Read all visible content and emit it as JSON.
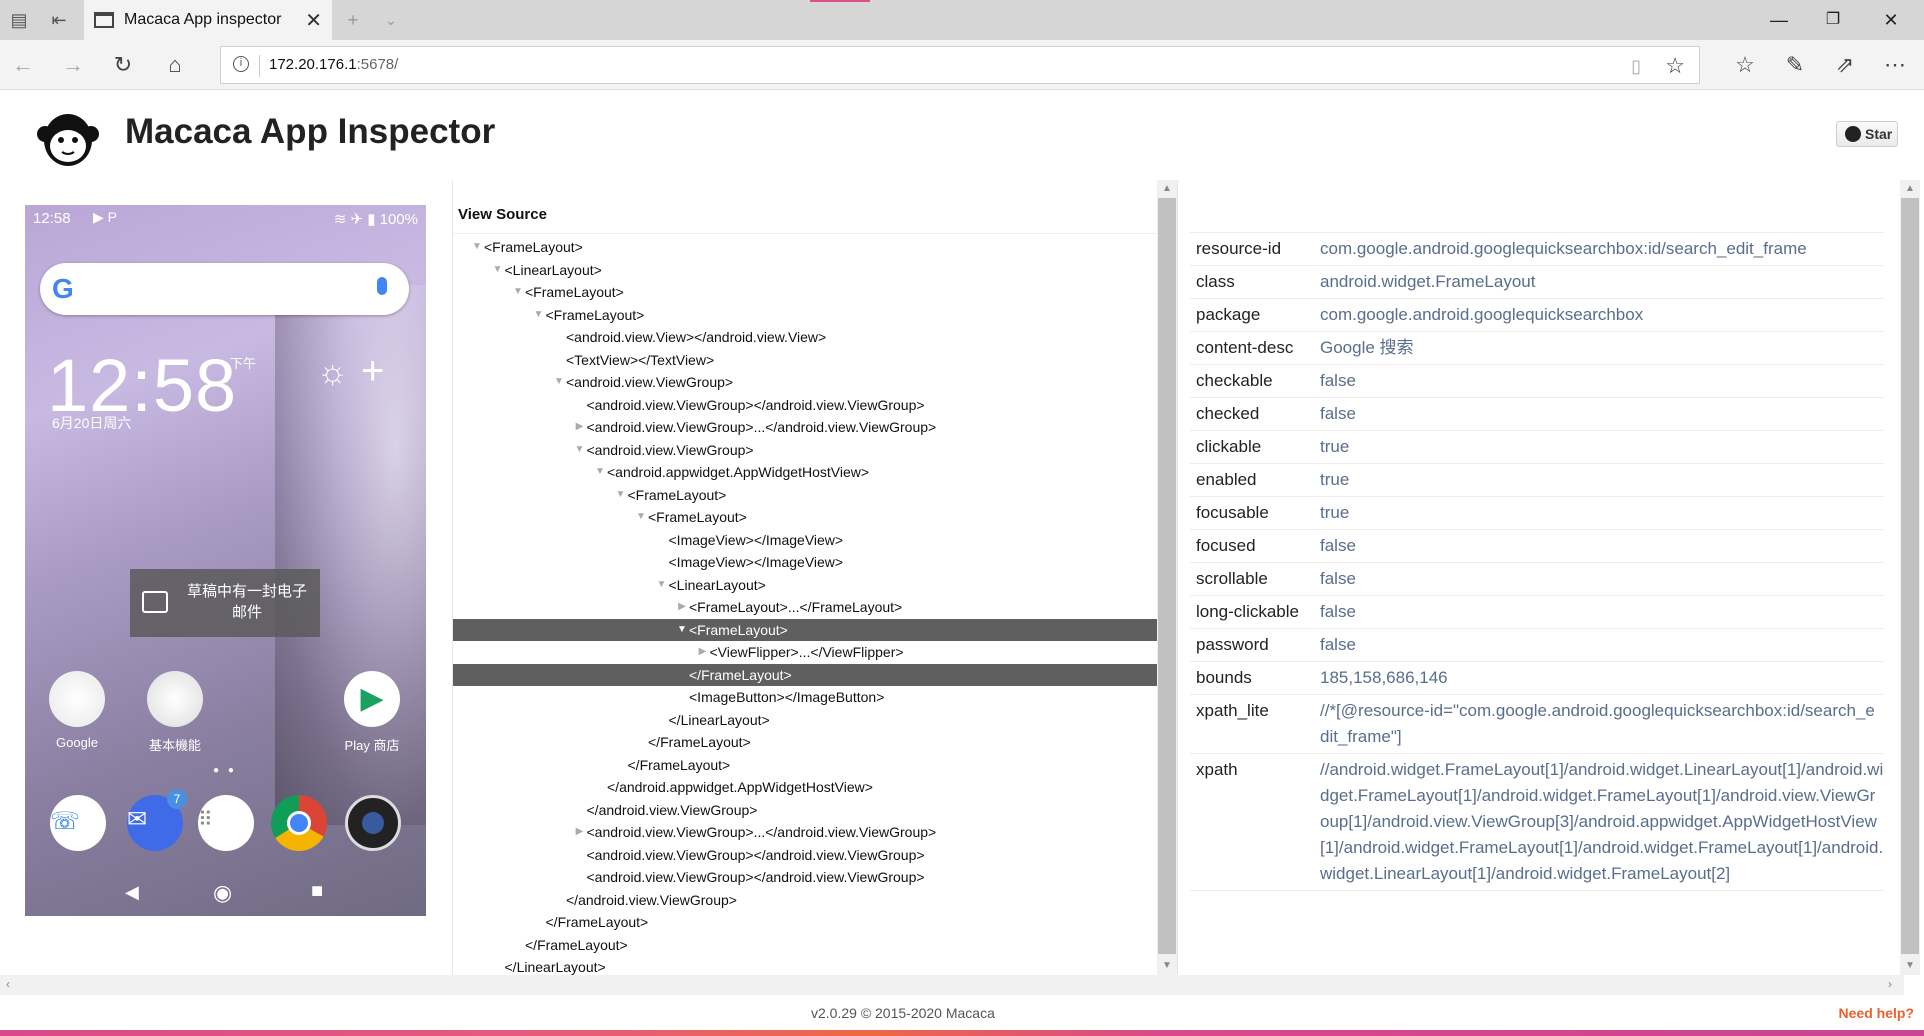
{
  "browser": {
    "tab_title": "Macaca App inspector",
    "url_host": "172.20.176.1",
    "url_rest": ":5678/"
  },
  "app": {
    "title": "Macaca App Inspector",
    "star_label": "Star"
  },
  "phone": {
    "status_time": "12:58",
    "battery": "100%",
    "clock": "12:58",
    "ampm": "下午",
    "date": "6月20日周六",
    "toast": "草稿中有一封电子邮件",
    "apps": [
      "Google",
      "基本機能",
      "Play 商店"
    ],
    "badge": "7"
  },
  "view_source": {
    "header": "View Source",
    "nodes": [
      {
        "indent": 0,
        "arrow": "▼",
        "text": "<FrameLayout>"
      },
      {
        "indent": 1,
        "arrow": "▼",
        "text": "<LinearLayout>"
      },
      {
        "indent": 2,
        "arrow": "▼",
        "text": "<FrameLayout>"
      },
      {
        "indent": 3,
        "arrow": "▼",
        "text": "<FrameLayout>"
      },
      {
        "indent": 4,
        "arrow": "",
        "text": "<android.view.View></android.view.View>"
      },
      {
        "indent": 4,
        "arrow": "",
        "text": "<TextView></TextView>"
      },
      {
        "indent": 4,
        "arrow": "▼",
        "text": "<android.view.ViewGroup>"
      },
      {
        "indent": 5,
        "arrow": "",
        "text": "<android.view.ViewGroup></android.view.ViewGroup>"
      },
      {
        "indent": 5,
        "arrow": "▶",
        "text": "<android.view.ViewGroup>...</android.view.ViewGroup>"
      },
      {
        "indent": 5,
        "arrow": "▼",
        "text": "<android.view.ViewGroup>"
      },
      {
        "indent": 6,
        "arrow": "▼",
        "text": "<android.appwidget.AppWidgetHostView>"
      },
      {
        "indent": 7,
        "arrow": "▼",
        "text": "<FrameLayout>"
      },
      {
        "indent": 8,
        "arrow": "▼",
        "text": "<FrameLayout>"
      },
      {
        "indent": 9,
        "arrow": "",
        "text": "<ImageView></ImageView>"
      },
      {
        "indent": 9,
        "arrow": "",
        "text": "<ImageView></ImageView>"
      },
      {
        "indent": 9,
        "arrow": "▼",
        "text": "<LinearLayout>"
      },
      {
        "indent": 10,
        "arrow": "▶",
        "text": "<FrameLayout>...</FrameLayout>"
      },
      {
        "indent": 10,
        "arrow": "▼",
        "text": "<FrameLayout>",
        "selected": true
      },
      {
        "indent": 11,
        "arrow": "▶",
        "text": "<ViewFlipper>...</ViewFlipper>"
      },
      {
        "indent": 10,
        "arrow": "",
        "text": "</FrameLayout>",
        "selected": true
      },
      {
        "indent": 10,
        "arrow": "",
        "text": "<ImageButton></ImageButton>"
      },
      {
        "indent": 9,
        "arrow": "",
        "text": "</LinearLayout>"
      },
      {
        "indent": 8,
        "arrow": "",
        "text": "</FrameLayout>"
      },
      {
        "indent": 7,
        "arrow": "",
        "text": "</FrameLayout>"
      },
      {
        "indent": 6,
        "arrow": "",
        "text": "</android.appwidget.AppWidgetHostView>"
      },
      {
        "indent": 5,
        "arrow": "",
        "text": "</android.view.ViewGroup>"
      },
      {
        "indent": 5,
        "arrow": "▶",
        "text": "<android.view.ViewGroup>...</android.view.ViewGroup>"
      },
      {
        "indent": 5,
        "arrow": "",
        "text": "<android.view.ViewGroup></android.view.ViewGroup>"
      },
      {
        "indent": 5,
        "arrow": "",
        "text": "<android.view.ViewGroup></android.view.ViewGroup>"
      },
      {
        "indent": 4,
        "arrow": "",
        "text": "</android.view.ViewGroup>"
      },
      {
        "indent": 3,
        "arrow": "",
        "text": "</FrameLayout>"
      },
      {
        "indent": 2,
        "arrow": "",
        "text": "</FrameLayout>"
      },
      {
        "indent": 1,
        "arrow": "",
        "text": "</LinearLayout>"
      }
    ]
  },
  "attributes": [
    {
      "key": "resource-id",
      "value": "com.google.android.googlequicksearchbox:id/search_edit_frame"
    },
    {
      "key": "class",
      "value": "android.widget.FrameLayout"
    },
    {
      "key": "package",
      "value": "com.google.android.googlequicksearchbox"
    },
    {
      "key": "content-desc",
      "value": "Google 搜索"
    },
    {
      "key": "checkable",
      "value": "false"
    },
    {
      "key": "checked",
      "value": "false"
    },
    {
      "key": "clickable",
      "value": "true"
    },
    {
      "key": "enabled",
      "value": "true"
    },
    {
      "key": "focusable",
      "value": "true"
    },
    {
      "key": "focused",
      "value": "false"
    },
    {
      "key": "scrollable",
      "value": "false"
    },
    {
      "key": "long-clickable",
      "value": "false"
    },
    {
      "key": "password",
      "value": "false"
    },
    {
      "key": "bounds",
      "value": "185,158,686,146"
    },
    {
      "key": "xpath_lite",
      "value": "//*[@resource-id=\"com.google.android.googlequicksearchbox:id/search_edit_frame\"]"
    },
    {
      "key": "xpath",
      "value": "//android.widget.FrameLayout[1]/android.widget.LinearLayout[1]/android.widget.FrameLayout[1]/android.widget.FrameLayout[1]/android.view.ViewGroup[1]/android.view.ViewGroup[3]/android.appwidget.AppWidgetHostView[1]/android.widget.FrameLayout[1]/android.widget.FrameLayout[1]/android.widget.LinearLayout[1]/android.widget.FrameLayout[2]"
    }
  ],
  "footer": {
    "version": "v2.0.29   © 2015-2020 Macaca",
    "help": "Need help?"
  }
}
